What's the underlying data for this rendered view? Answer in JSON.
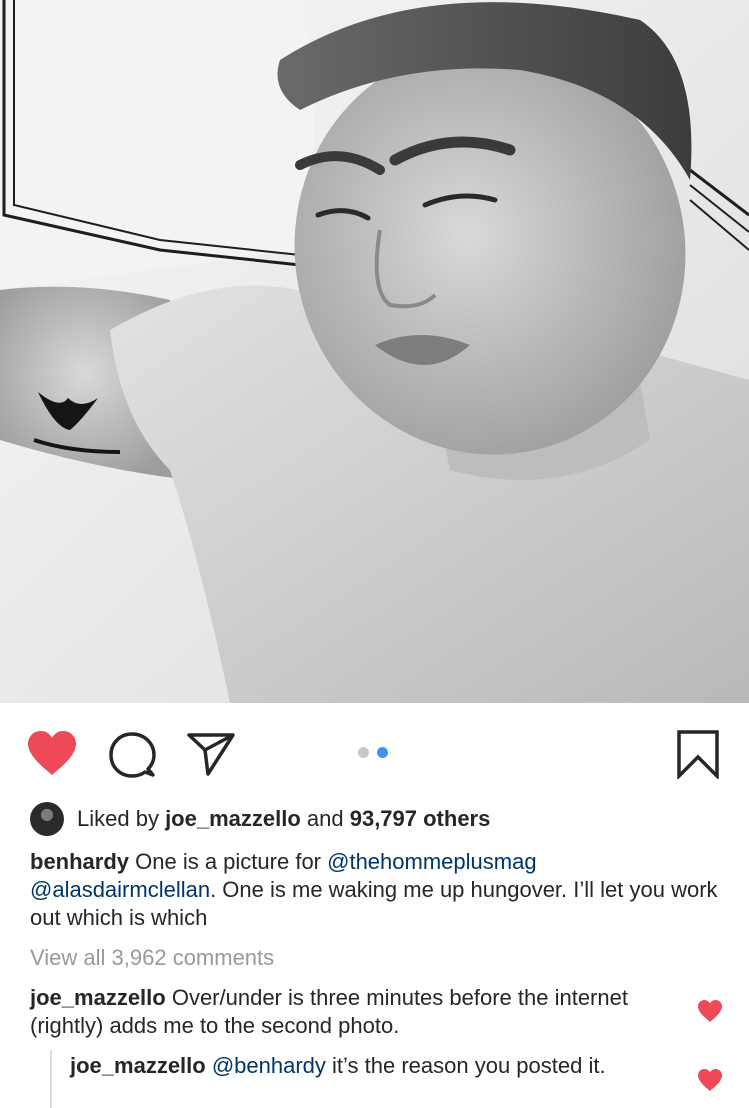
{
  "post": {
    "photo_alt": "",
    "carousel": {
      "total": 2,
      "active_index": 1
    }
  },
  "actions": {
    "like_icon": "heart-filled-icon",
    "comment_icon": "comment-bubble-icon",
    "share_icon": "paper-plane-icon",
    "save_icon": "bookmark-icon",
    "like_color": "#ed4956",
    "active_dot_color": "#3897f0"
  },
  "likes": {
    "prefix": "Liked by ",
    "user": "joe_mazzello",
    "middle": " and ",
    "count": "93,797 others"
  },
  "caption": {
    "username": "benhardy",
    "text1": " One is a picture for ",
    "mention1": "@thehommeplusmag",
    "space": " ",
    "mention2": "@alasdairmclellan",
    "text2": ". One is me waking me up hungover. I’ll let you work out which is which"
  },
  "view_all_comments": "View all 3,962 comments",
  "comments": [
    {
      "username": "joe_mazzello",
      "text": " Over/under is three minutes before the internet (rightly) adds me to the second photo."
    },
    {
      "username": "joe_mazzello",
      "mention": "@benhardy",
      "text": " it’s the reason you posted it."
    }
  ]
}
